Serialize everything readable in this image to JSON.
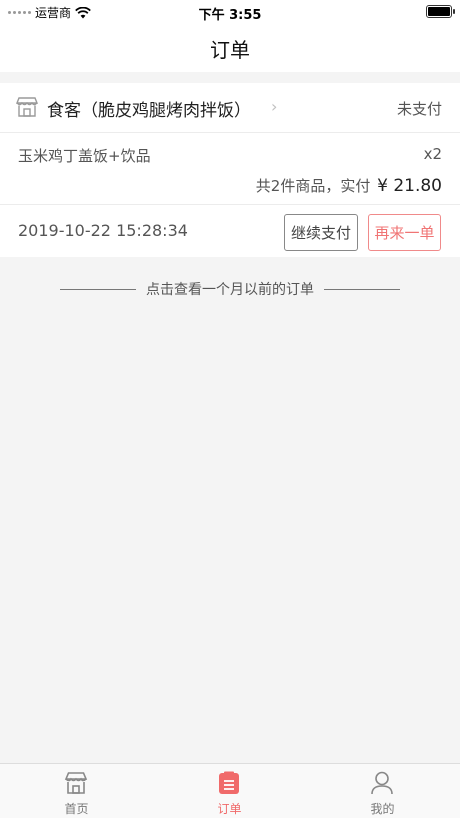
{
  "status_bar": {
    "carrier": "运营商",
    "time": "下午 3:55"
  },
  "nav": {
    "title": "订单"
  },
  "order": {
    "store_name": "食客（脆皮鸡腿烤肉拌饭）",
    "store_chevron": "›",
    "status": "未支付",
    "item_name": "玉米鸡丁盖饭+饮品",
    "item_qty": "x2",
    "summary_text": "共2件商品，实付",
    "price": "¥ 21.80",
    "time": "2019-10-22 15:28:34",
    "pay_button": "继续支付",
    "reorder_button": "再来一单"
  },
  "history_link": "点击查看一个月以前的订单",
  "tabs": [
    {
      "label": "首页",
      "icon": "store-icon",
      "active": false
    },
    {
      "label": "订单",
      "icon": "order-list-icon",
      "active": true
    },
    {
      "label": "我的",
      "icon": "person-icon",
      "active": false
    }
  ],
  "colors": {
    "accent": "#f06a6a",
    "background": "#f4f4f4"
  }
}
